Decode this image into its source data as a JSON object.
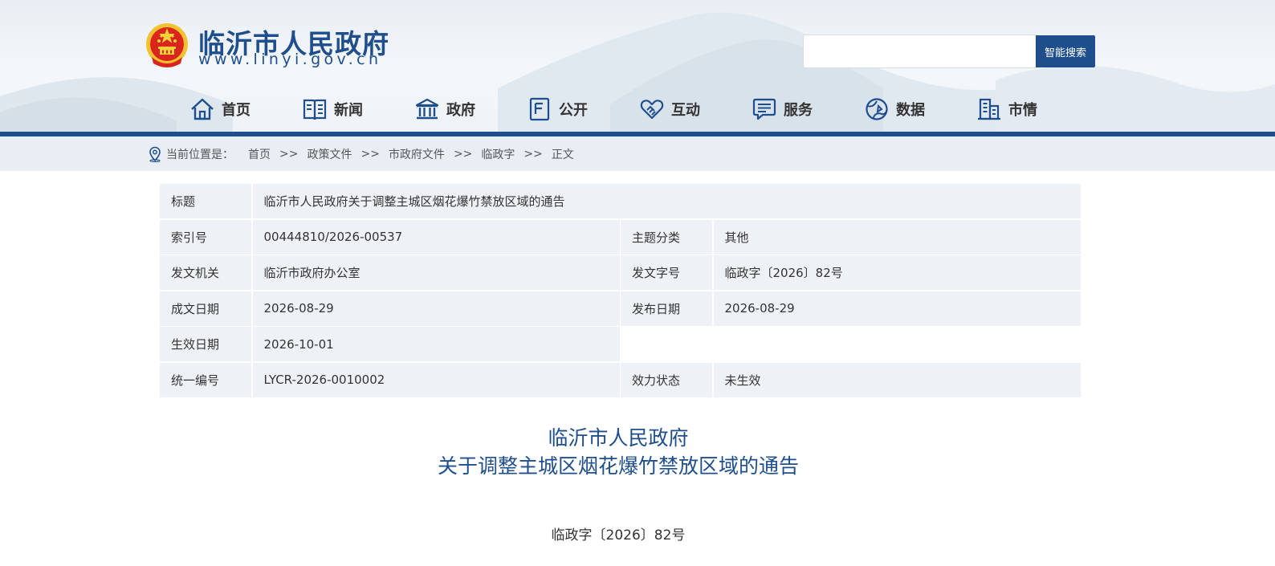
{
  "header": {
    "site_title": "临沂市人民政府",
    "site_url": "www.linyi.gov.cn",
    "emblem": "national-emblem"
  },
  "search": {
    "placeholder": "",
    "button_label": "智能搜索"
  },
  "nav": {
    "items": [
      {
        "label": "首页",
        "icon": "home-icon"
      },
      {
        "label": "新闻",
        "icon": "newspaper-icon"
      },
      {
        "label": "政府",
        "icon": "government-building-icon"
      },
      {
        "label": "公开",
        "icon": "document-icon"
      },
      {
        "label": "互动",
        "icon": "handshake-icon"
      },
      {
        "label": "服务",
        "icon": "chat-service-icon"
      },
      {
        "label": "数据",
        "icon": "data-globe-icon"
      },
      {
        "label": "市情",
        "icon": "city-building-icon"
      }
    ]
  },
  "breadcrumb": {
    "label": "当前位置是：",
    "separator": ">>",
    "items": [
      "首页",
      "政策文件",
      "市政府文件",
      "临政字",
      "正文"
    ]
  },
  "info": {
    "title_label": "标题",
    "title_value": "临沂市人民政府关于调整主城区烟花爆竹禁放区域的通告",
    "index_label": "索引号",
    "index_value": "00444810/2026-00537",
    "topic_label": "主题分类",
    "topic_value": "其他",
    "issuer_label": "发文机关",
    "issuer_value": "临沂市政府办公室",
    "doc_no_label": "发文字号",
    "doc_no_value": "临政字〔2026〕82号",
    "written_label": "成文日期",
    "written_value": "2026-08-29",
    "published_label": "发布日期",
    "published_value": "2026-08-29",
    "effective_label": "生效日期",
    "effective_value": "2026-10-01",
    "code_label": "统一编号",
    "code_value": "LYCR-2026-0010002",
    "status_label": "效力状态",
    "status_value": "未生效"
  },
  "document": {
    "title_line1": "临沂市人民政府",
    "title_line2": "关于调整主城区烟花爆竹禁放区域的通告",
    "number": "临政字〔2026〕82号"
  },
  "colors": {
    "brand_blue": "#1f4e8c",
    "table_bg": "#eef2f6",
    "breadcrumb_bg": "#e8eef3"
  }
}
